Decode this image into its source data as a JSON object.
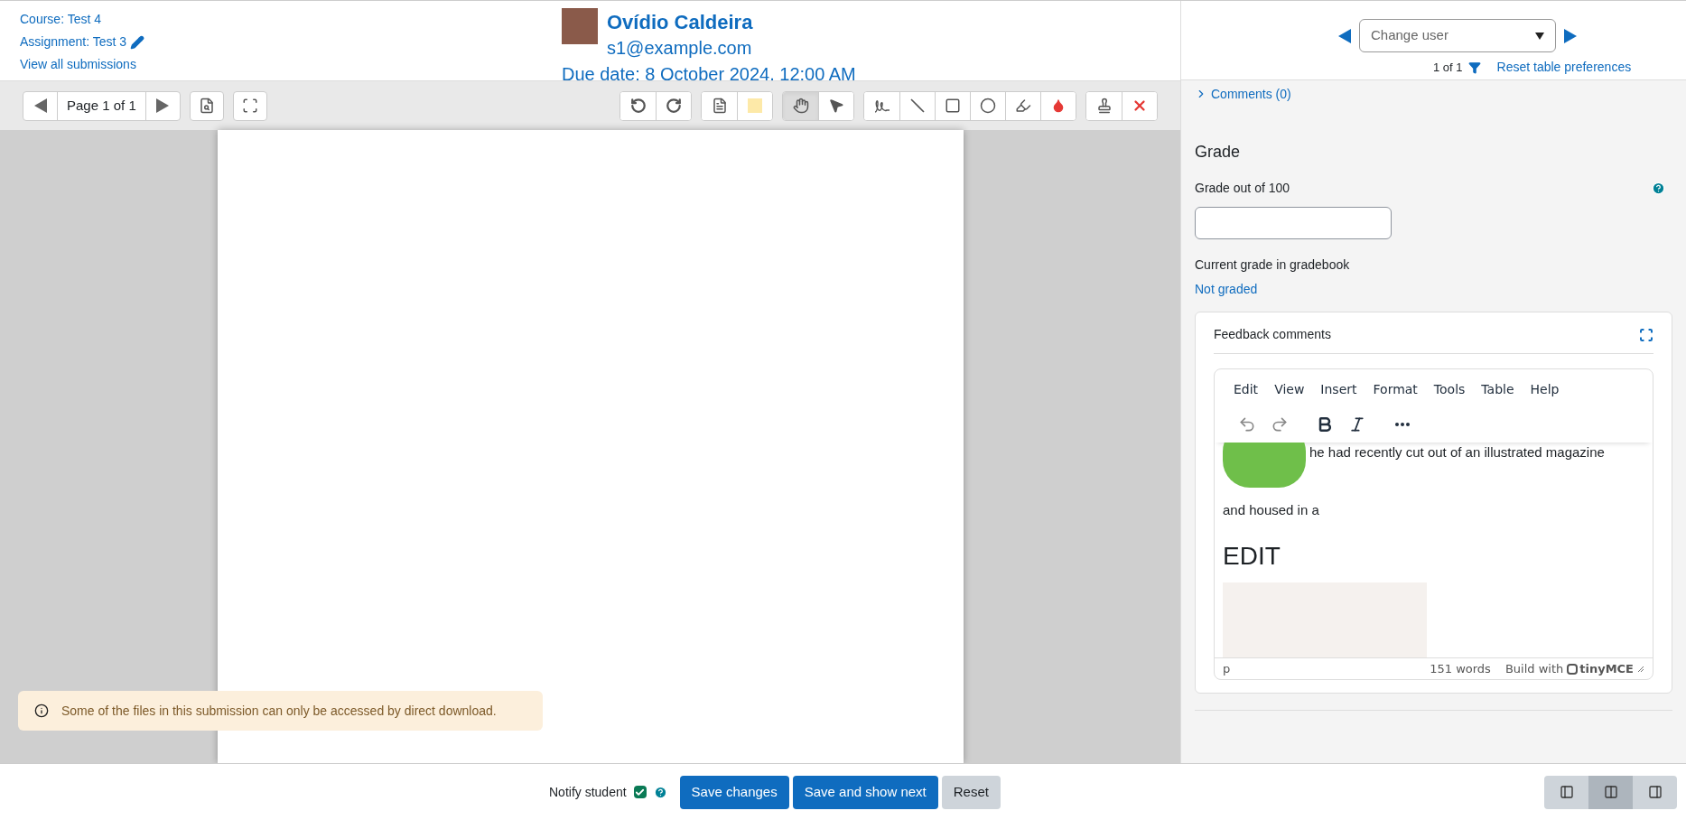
{
  "header": {
    "course": "Course: Test 4",
    "assignment": "Assignment: Test 3",
    "view_all": "View all submissions",
    "user_name": "Ovídio Caldeira",
    "user_email": "s1@example.com",
    "due_date": "Due date: 8 October 2024, 12:00 AM",
    "change_user": {
      "placeholder": "Change user"
    },
    "count": "1 of 1",
    "reset_link": "Reset table preferences"
  },
  "viewer": {
    "page_label": "Page 1 of 1",
    "tool_groups": [
      [
        {
          "kind": "rotate-left",
          "selected": false
        },
        {
          "kind": "rotate-right",
          "selected": false
        }
      ],
      [
        {
          "kind": "comment",
          "selected": false
        },
        {
          "kind": "note-color",
          "selected": false
        }
      ],
      [
        {
          "kind": "hand",
          "selected": true
        },
        {
          "kind": "select",
          "selected": false
        }
      ],
      [
        {
          "kind": "pen",
          "selected": false
        },
        {
          "kind": "line",
          "selected": false
        },
        {
          "kind": "rectangle",
          "selected": false
        },
        {
          "kind": "oval",
          "selected": false
        },
        {
          "kind": "highlight",
          "selected": false
        },
        {
          "kind": "color",
          "selected": false
        }
      ],
      [
        {
          "kind": "stamp",
          "selected": false
        },
        {
          "kind": "delete",
          "selected": false
        }
      ]
    ],
    "notice": "Some of the files in this submission can only be accessed by direct download."
  },
  "panel": {
    "comments_link": "Comments (0)",
    "grade_heading": "Grade",
    "grade_label": "Grade out of 100",
    "current_grade_label": "Current grade in gradebook",
    "current_grade": "Not graded",
    "feedback": {
      "title": "Feedback comments",
      "menu": [
        "Edit",
        "View",
        "Insert",
        "Format",
        "Tools",
        "Table",
        "Help"
      ],
      "toolbar": [
        {
          "kind": "undo"
        },
        {
          "kind": "redo"
        },
        {
          "kind": "bold"
        },
        {
          "kind": "italic"
        },
        {
          "kind": "more"
        }
      ],
      "content": [
        {
          "kind": "image-text",
          "text": "he had recently cut out of an illustrated magazine"
        },
        {
          "kind": "paragraph",
          "text": "and housed in a"
        },
        {
          "kind": "heading",
          "text": "EDIT"
        },
        {
          "kind": "image"
        }
      ],
      "status_path": "p",
      "word_count": "151 words",
      "build_with": "Build with",
      "brand": "tinyMCE"
    }
  },
  "footer": {
    "notify_label": "Notify student",
    "notify_checked": true,
    "buttons": [
      {
        "label": "Save changes",
        "kind": "primary"
      },
      {
        "label": "Save and show next",
        "kind": "primary"
      },
      {
        "label": "Reset",
        "kind": "secondary"
      }
    ],
    "layouts": [
      {
        "kind": "left",
        "selected": false
      },
      {
        "kind": "both",
        "selected": true
      },
      {
        "kind": "right",
        "selected": false
      }
    ]
  }
}
